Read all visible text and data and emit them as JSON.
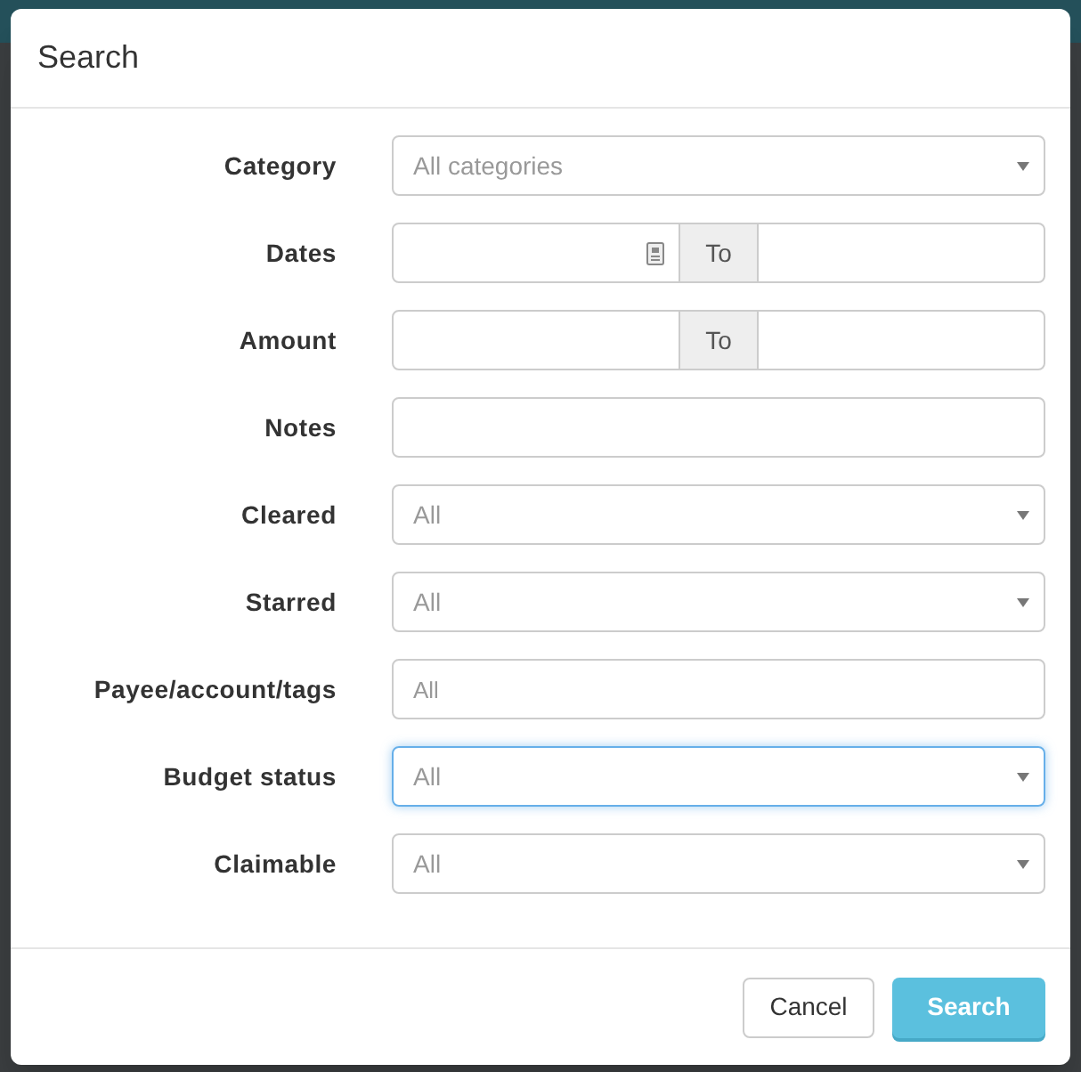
{
  "dialog": {
    "title": "Search",
    "fields": [
      {
        "label": "Category",
        "kind": "select",
        "value": "All categories",
        "focused": false
      },
      {
        "label": "Dates",
        "kind": "date_range",
        "separator": "To",
        "focused": false
      },
      {
        "label": "Amount",
        "kind": "range",
        "separator": "To",
        "focused": false
      },
      {
        "label": "Notes",
        "kind": "text",
        "focused": false
      },
      {
        "label": "Cleared",
        "kind": "select",
        "value": "All",
        "focused": false
      },
      {
        "label": "Starred",
        "kind": "select",
        "value": "All",
        "focused": false
      },
      {
        "label": "Payee/account/tags",
        "kind": "text",
        "placeholder": "All",
        "focused": false
      },
      {
        "label": "Budget status",
        "kind": "select",
        "value": "All",
        "focused": true
      },
      {
        "label": "Claimable",
        "kind": "select",
        "value": "All",
        "focused": false
      }
    ],
    "buttons": [
      {
        "label": "Cancel",
        "kind": "default"
      },
      {
        "label": "Search",
        "kind": "primary"
      }
    ]
  }
}
